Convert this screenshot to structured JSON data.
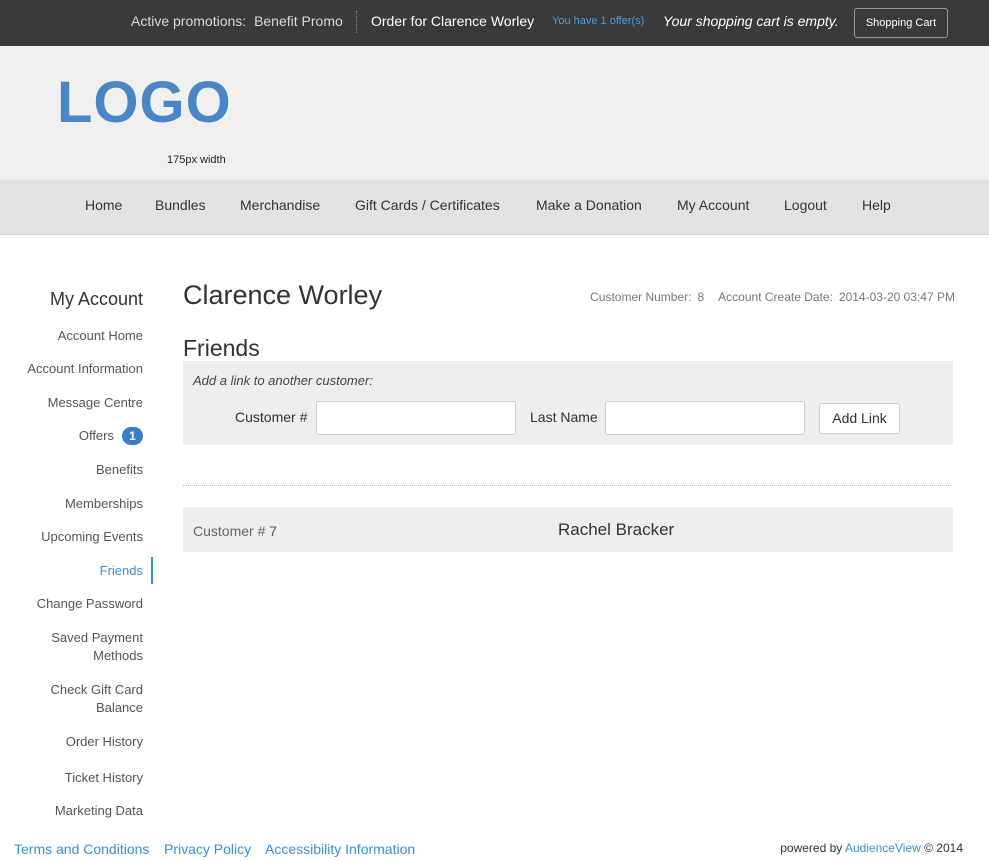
{
  "topbar": {
    "promo_label": "Active promotions:",
    "promo_name": "Benefit Promo",
    "order_for": "Order for Clarence Worley",
    "offers_text": "You have 1 offer(s)",
    "cart_status": "Your shopping cart is empty.",
    "cart_button": "Shopping Cart"
  },
  "header": {
    "logo": "LOGO",
    "logo_note": "175px width"
  },
  "nav": {
    "items": [
      "Home",
      "Bundles",
      "Merchandise",
      "Gift Cards / Certificates",
      "Make a Donation",
      "My Account",
      "Logout",
      "Help"
    ]
  },
  "sidebar": {
    "title": "My Account",
    "items": [
      {
        "label": "Account Home"
      },
      {
        "label": "Account Information"
      },
      {
        "label": "Message Centre"
      },
      {
        "label": "Offers",
        "badge": "1"
      },
      {
        "label": "Benefits"
      },
      {
        "label": "Memberships"
      },
      {
        "label": "Upcoming Events"
      },
      {
        "label": "Friends",
        "active": true
      },
      {
        "label": "Change Password"
      },
      {
        "label": "Saved Payment",
        "label2": "Methods"
      },
      {
        "label": "Check Gift Card",
        "label2": "Balance"
      },
      {
        "label": "Order History"
      },
      {
        "label": "Ticket History"
      },
      {
        "label": "Marketing Data"
      }
    ]
  },
  "main": {
    "customer_name": "Clarence Worley",
    "customer_number_label": "Customer Number:",
    "customer_number": "8",
    "create_date_label": "Account Create Date:",
    "create_date": "2014-03-20 03:47 PM",
    "section_title": "Friends",
    "add_hint": "Add a link to another customer:",
    "customer_num_field_label": "Customer #",
    "customer_num_field_value": "",
    "last_name_field_label": "Last Name",
    "last_name_field_value": "",
    "add_button": "Add Link",
    "friends": [
      {
        "customer_label": "Customer #",
        "customer_number": "7",
        "name": "Rachel Bracker"
      }
    ]
  },
  "footer": {
    "links": [
      "Terms and Conditions",
      "Privacy Policy",
      "Accessibility Information"
    ],
    "powered_by": "powered by",
    "brand": "AudienceView",
    "copyright": "© 2014"
  },
  "colors": {
    "accent": "#3a8fd6",
    "logo": "#4a86c5",
    "topbar": "#3a3a3a"
  }
}
